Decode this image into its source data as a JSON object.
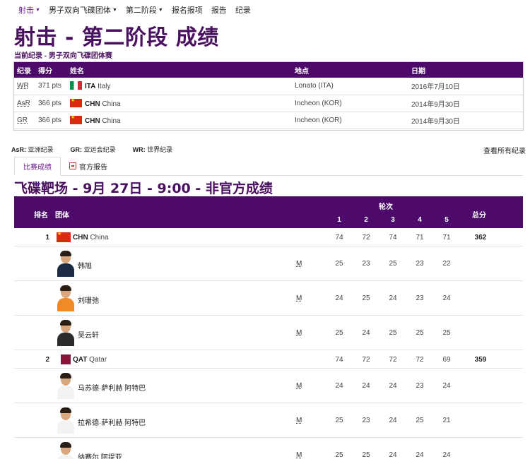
{
  "nav": [
    "射击",
    "男子双向飞碟团体",
    "第二阶段",
    "报名报项",
    "报告",
    "纪录"
  ],
  "nav_dropdown": [
    true,
    true,
    true,
    false,
    false,
    false
  ],
  "title": "射击 - 第二阶段 成绩",
  "subtitle": "当前纪录 - 男子双向飞碟团体赛",
  "records": {
    "headers": [
      "纪录",
      "得分",
      "姓名",
      "地点",
      "日期"
    ],
    "rows": [
      {
        "code": "WR",
        "score": "371 pts",
        "noc": "ITA",
        "country": "Italy",
        "flag": "ita",
        "place": "Lonato (ITA)",
        "date": "2016年7月10日"
      },
      {
        "code": "AsR",
        "score": "366 pts",
        "noc": "CHN",
        "country": "China",
        "flag": "chn",
        "place": "Incheon (KOR)",
        "date": "2014年9月30日"
      },
      {
        "code": "GR",
        "score": "366 pts",
        "noc": "CHN",
        "country": "China",
        "flag": "chn",
        "place": "Incheon (KOR)",
        "date": "2014年9月30日"
      }
    ]
  },
  "legend": [
    {
      "key": "AsR:",
      "text": "亚洲纪录"
    },
    {
      "key": "GR:",
      "text": "亚运会纪录"
    },
    {
      "key": "WR:",
      "text": "世界纪录"
    }
  ],
  "view_all": "查看所有纪录",
  "tabs": [
    "比赛成绩",
    "官方报告"
  ],
  "section_title": "飞碟靶场 - 9月 27日 - 9:00 - 非官方成绩",
  "results": {
    "headers": {
      "rank": "排名",
      "team": "团体",
      "rounds": "轮次",
      "round_numbers": [
        "1",
        "2",
        "3",
        "4",
        "5"
      ],
      "total": "总分"
    },
    "teams": [
      {
        "rank": "1",
        "noc": "CHN",
        "country": "China",
        "flag": "chn",
        "scores": [
          "74",
          "72",
          "74",
          "71",
          "71"
        ],
        "total": "362",
        "athletes": [
          {
            "name": "韩旭",
            "gender": "M",
            "scores": [
              "25",
              "23",
              "25",
              "23",
              "22"
            ],
            "shirt": "#1d2a44"
          },
          {
            "name": "刘珊弛",
            "gender": "M",
            "scores": [
              "24",
              "25",
              "24",
              "23",
              "24"
            ],
            "shirt": "#f08a24"
          },
          {
            "name": "吴云轩",
            "gender": "M",
            "scores": [
              "25",
              "24",
              "25",
              "25",
              "25"
            ],
            "shirt": "#2b2b2b"
          }
        ]
      },
      {
        "rank": "2",
        "noc": "QAT",
        "country": "Qatar",
        "flag": "qat",
        "scores": [
          "74",
          "72",
          "72",
          "72",
          "69"
        ],
        "total": "359",
        "athletes": [
          {
            "name": "马苏德·萨利赫 阿特巴",
            "gender": "M",
            "scores": [
              "24",
              "24",
              "24",
              "23",
              "24"
            ],
            "shirt": "#f2f2f2"
          },
          {
            "name": "拉希德·萨利赫 阿特巴",
            "gender": "M",
            "scores": [
              "25",
              "23",
              "24",
              "25",
              "21"
            ],
            "shirt": "#f2f2f2"
          },
          {
            "name": "纳赛尔 阿提亚",
            "gender": "M",
            "scores": [
              "25",
              "25",
              "24",
              "24",
              "24"
            ],
            "shirt": "#f2f2f2"
          }
        ]
      }
    ]
  }
}
